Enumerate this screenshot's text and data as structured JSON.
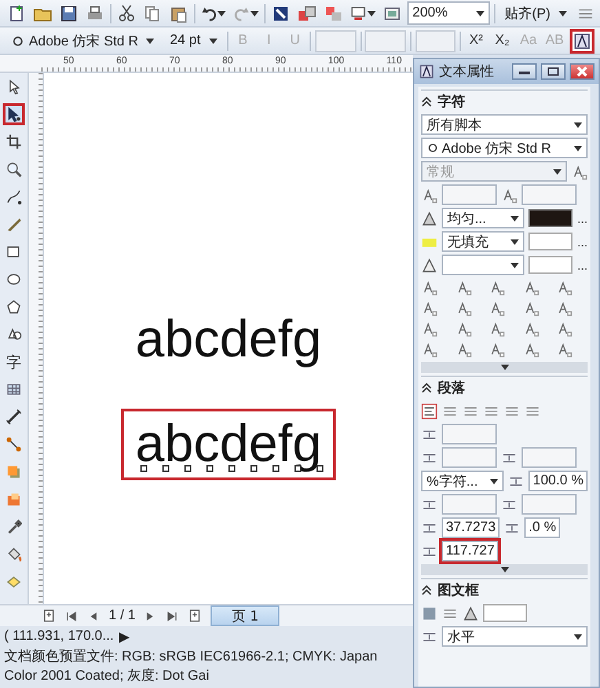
{
  "toolbar_standard": {
    "buttons": [
      {
        "kind": "new"
      },
      {
        "kind": "open"
      },
      {
        "kind": "save"
      },
      {
        "kind": "print"
      },
      {
        "kind": "cut"
      },
      {
        "kind": "copy"
      },
      {
        "kind": "paste"
      },
      {
        "kind": "undo"
      },
      {
        "kind": "redo"
      },
      {
        "kind": "import"
      },
      {
        "kind": "export"
      },
      {
        "kind": "publish"
      },
      {
        "kind": "launcher"
      },
      {
        "kind": "window"
      }
    ],
    "zoom": "200%",
    "snap": "贴齐(P)"
  },
  "toolbar_text": {
    "font": "Adobe 仿宋 Std R",
    "size": "24 pt",
    "format_buttons": [
      {
        "glyph": "B",
        "disabled": true
      },
      {
        "glyph": "I",
        "disabled": true
      },
      {
        "glyph": "U",
        "disabled": true
      }
    ],
    "spinners": [
      {
        "disabled": true
      },
      {
        "disabled": true
      },
      {
        "disabled": true
      }
    ],
    "script_buttons": [
      {
        "glyph": "X²",
        "disabled": false
      },
      {
        "glyph": "X₂",
        "disabled": false
      },
      {
        "glyph": "Aa",
        "disabled": true
      },
      {
        "glyph": "AB",
        "disabled": true
      }
    ],
    "text_properties": {
      "highlighted": true
    }
  },
  "ruler": {
    "ticks": [
      "50",
      "60",
      "70",
      "80",
      "90",
      "100",
      "110"
    ]
  },
  "toolbox": {
    "tools": [
      {
        "kind": "pick",
        "selected": false,
        "highlighted": false
      },
      {
        "kind": "shape",
        "selected": true,
        "highlighted": true
      },
      {
        "kind": "crop",
        "selected": false,
        "highlighted": false
      },
      {
        "kind": "zoom",
        "selected": false,
        "highlighted": false
      },
      {
        "kind": "freehand",
        "selected": false,
        "highlighted": false
      },
      {
        "kind": "artistic",
        "selected": false,
        "highlighted": false
      },
      {
        "kind": "rectangle",
        "selected": false,
        "highlighted": false
      },
      {
        "kind": "ellipse",
        "selected": false,
        "highlighted": false
      },
      {
        "kind": "polygon",
        "selected": false,
        "highlighted": false
      },
      {
        "kind": "shapes",
        "selected": false,
        "highlighted": false
      },
      {
        "kind": "text",
        "glyph": "字",
        "selected": false,
        "highlighted": false
      },
      {
        "kind": "table",
        "selected": false,
        "highlighted": false
      },
      {
        "kind": "dimension",
        "selected": false,
        "highlighted": false
      },
      {
        "kind": "connector",
        "selected": false,
        "highlighted": false
      },
      {
        "kind": "shadow",
        "selected": false,
        "highlighted": false
      },
      {
        "kind": "transparency",
        "selected": false,
        "highlighted": false
      },
      {
        "kind": "eyedropper",
        "selected": false,
        "highlighted": false
      },
      {
        "kind": "fill",
        "selected": false,
        "highlighted": false
      },
      {
        "kind": "smartfill",
        "selected": false,
        "highlighted": false
      }
    ]
  },
  "canvas": {
    "texts": [
      {
        "text": "abcdefg",
        "selected": false,
        "highlighted": false
      },
      {
        "text": "abcdefg",
        "selected": true,
        "highlighted": true
      }
    ]
  },
  "page_nav": {
    "counter": "1 / 1",
    "tabs": [
      {
        "label": "页 1",
        "selected": true
      }
    ]
  },
  "status_bar": {
    "coordinates": "( 111.931, 170.0...",
    "arrow": "▶",
    "profile": "文档颜色预置文件: RGB: sRGB IEC61966-2.1; CMYK: Japan Color 2001 Coated; 灰度: Dot Gai"
  },
  "docker": {
    "title": "文本属性",
    "sections": [
      {
        "kind": "character",
        "title": "字符",
        "expanded": true,
        "script": "所有脚本",
        "font": "Adobe 仿宋 Std R",
        "style": {
          "value": "常规",
          "disabled": true
        },
        "fill_type": "均匀...",
        "background_fill": "无填充",
        "more_buttons": [
          "...",
          "...",
          "..."
        ]
      },
      {
        "kind": "paragraph",
        "title": "段落",
        "expanded": true,
        "spacing_unit": "%字符...",
        "line_spacing": "100.0 %",
        "char_spacing": "37.7273",
        "word_spacing": ".0 %",
        "language_spacing": {
          "value": "117.727",
          "highlighted": true
        }
      },
      {
        "kind": "frame",
        "title": "图文框",
        "expanded": true,
        "direction": "水平"
      }
    ]
  }
}
